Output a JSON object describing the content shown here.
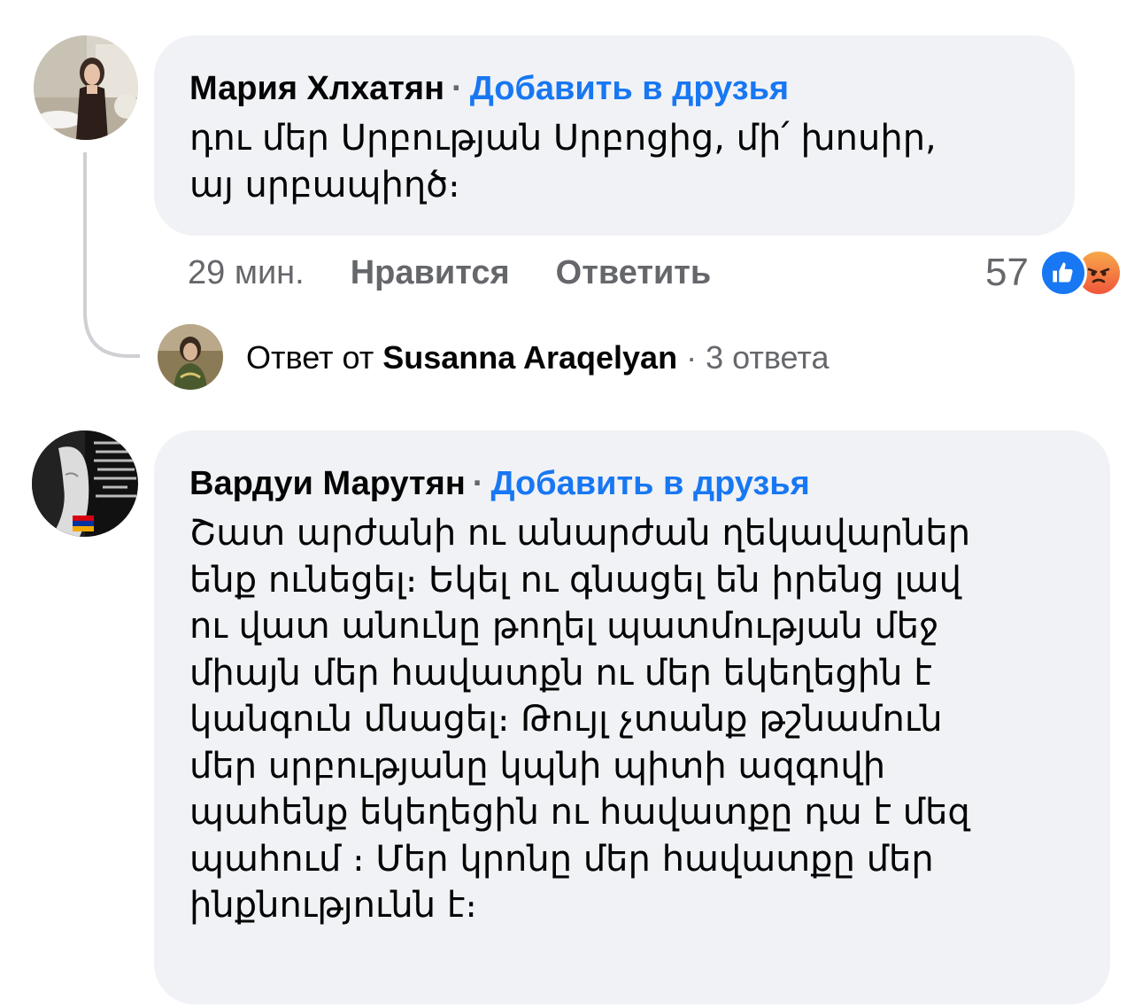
{
  "comments": [
    {
      "author": "Мария Хлхатян",
      "separator": "·",
      "add_friend": "Добавить в друзья",
      "text_lines": [
        "դու մեր Սրբության Սրբոցից, մի՛ խոսիր,",
        "այ սրբապիղծ։"
      ],
      "time": "29 мин.",
      "like": "Нравится",
      "reply": "Ответить",
      "reaction_count": "57",
      "reactions": [
        "like-icon",
        "angry-icon"
      ],
      "colors": {
        "like": "#1877f2",
        "angry": "#f0563a"
      }
    },
    {
      "author": "Вардуи Марутян",
      "separator": "·",
      "add_friend": "Добавить в друзья",
      "text_lines": [
        "Շատ արժանի ու անարժան ղեկավարներ",
        "ենք ունեցել։ Եկել ու գնացել են իրենց լավ",
        "ու վատ անունը թողել պատմության մեջ",
        "միայն մեր հավատքն ու մեր եկեղեցին է",
        "կանգուն մնացել։ Թույլ չտանք թշնամուն",
        "մեր սրբությանը կպնի պիտի ազգովի",
        "պահենք եկեղեցին ու հավատքը դա է մեզ",
        "պահում ։ Մեր կրոնը մեր հավատքը մեր",
        "ինքնությունն է։"
      ]
    }
  ],
  "reply_summary": {
    "prefix": "Ответ от",
    "name": "Susanna Araqelyan",
    "separator": "·",
    "count": "3 ответа"
  },
  "theme": {
    "bubble_bg": "#f0f2f5",
    "link_blue": "#1877f2",
    "secondary_text": "#65676b",
    "thread_line": "#ced0d4"
  }
}
